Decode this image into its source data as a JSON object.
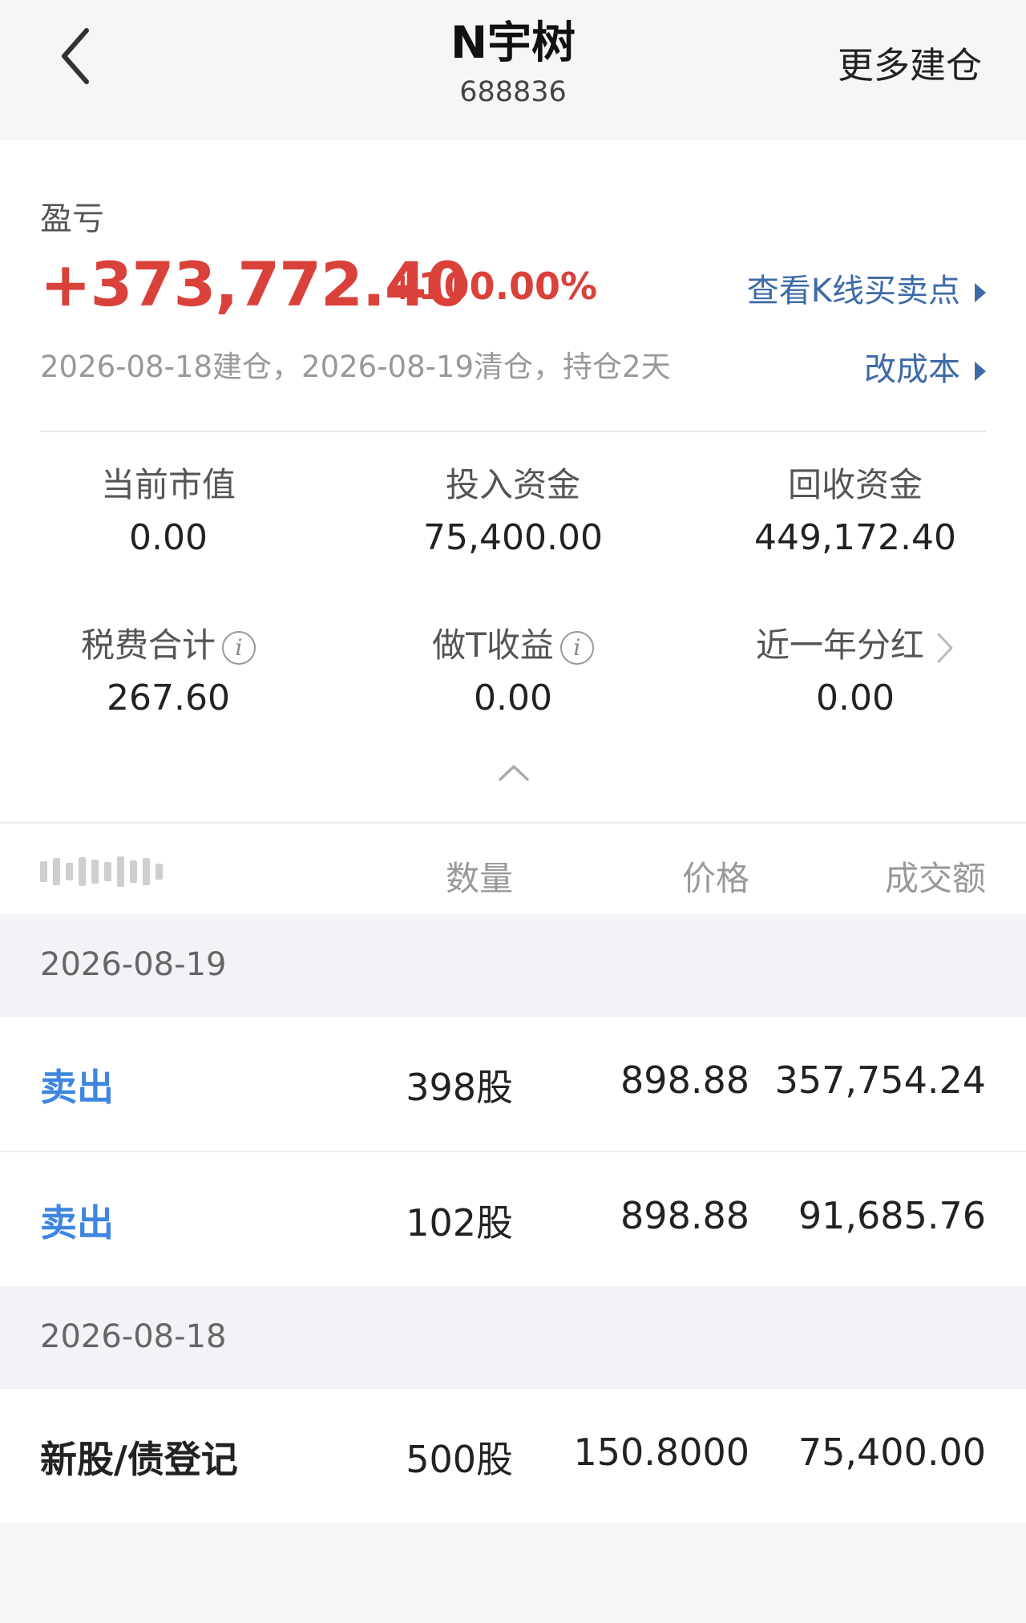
{
  "header": {
    "title": "N宇树",
    "code": "688836",
    "more_label": "更多建仓"
  },
  "summary": {
    "pl_label": "盈亏",
    "pl_value": "+373,772.40",
    "pl_percent": "+100.00%",
    "dates_text": "2026-08-18建仓，2026-08-19清仓，持仓2天",
    "link_kline": "查看K线买卖点",
    "link_cost": "改成本",
    "stats": [
      {
        "label": "当前市值",
        "value": "0.00"
      },
      {
        "label": "投入资金",
        "value": "75,400.00"
      },
      {
        "label": "回收资金",
        "value": "449,172.40"
      },
      {
        "label": "税费合计",
        "value": "267.60"
      },
      {
        "label": "做T收益",
        "value": "0.00"
      },
      {
        "label": "近一年分红",
        "value": "0.00"
      }
    ],
    "colors": {
      "profit": "#d9413a",
      "link": "#3e6aa8",
      "sell": "#3e86e0"
    }
  },
  "table": {
    "columns": [
      "数量",
      "价格",
      "成交额"
    ],
    "groups": [
      {
        "date": "2026-08-19",
        "rows": [
          {
            "type": "卖出",
            "qty": "398股",
            "price": "898.88",
            "amount": "357,754.24"
          },
          {
            "type": "卖出",
            "qty": "102股",
            "price": "898.88",
            "amount": "91,685.76"
          }
        ]
      },
      {
        "date": "2026-08-18",
        "rows": [
          {
            "type": "新股/债登记",
            "qty": "500股",
            "price": "150.8000",
            "amount": "75,400.00"
          }
        ]
      }
    ]
  },
  "icons": [
    "back-arrow-icon",
    "triangle-right-icon",
    "info-icon",
    "chevron-right-icon",
    "chevron-up-icon"
  ]
}
